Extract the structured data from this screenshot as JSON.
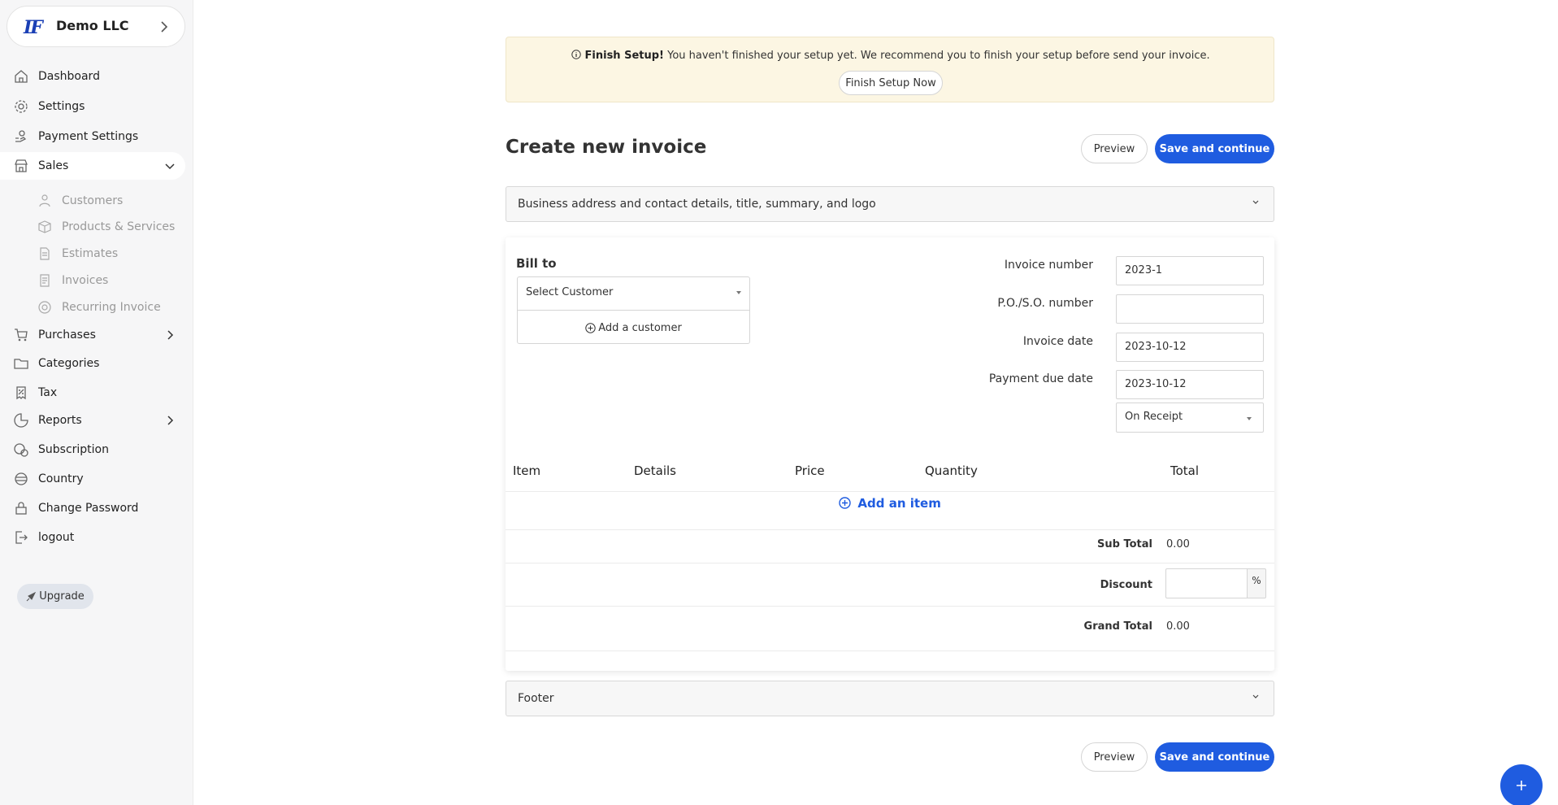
{
  "org": {
    "logo": "IF",
    "name": "Demo LLC"
  },
  "sidebar": {
    "items": [
      {
        "label": "Dashboard",
        "icon": "house-icon"
      },
      {
        "label": "Settings",
        "icon": "gear-icon"
      },
      {
        "label": "Payment Settings",
        "icon": "hand-coin-icon"
      },
      {
        "label": "Sales",
        "icon": "shop-icon",
        "expanded": true
      },
      {
        "label": "Purchases",
        "icon": "cart-icon"
      },
      {
        "label": "Categories",
        "icon": "folder-icon"
      },
      {
        "label": "Tax",
        "icon": "tax-icon"
      },
      {
        "label": "Reports",
        "icon": "chart-icon"
      },
      {
        "label": "Subscription",
        "icon": "subscription-icon"
      },
      {
        "label": "Country",
        "icon": "globe-icon"
      },
      {
        "label": "Change Password",
        "icon": "lock-icon"
      },
      {
        "label": "logout",
        "icon": "logout-icon"
      }
    ],
    "sales_sub": [
      {
        "label": "Customers",
        "icon": "customers-icon"
      },
      {
        "label": "Products & Services",
        "icon": "box-icon"
      },
      {
        "label": "Estimates",
        "icon": "document-icon"
      },
      {
        "label": "Invoices",
        "icon": "invoice-icon"
      },
      {
        "label": "Recurring Invoice",
        "icon": "recurring-icon"
      }
    ],
    "upgrade_label": "Upgrade"
  },
  "banner": {
    "title": "Finish Setup!",
    "message": "You haven't finished your setup yet. We recommend you to finish your setup before send your invoice.",
    "button": "Finish Setup Now"
  },
  "page": {
    "title": "Create new invoice",
    "preview_label": "Preview",
    "save_label": "Save and continue"
  },
  "business_section": {
    "label": "Business address and contact details, title, summary, and logo"
  },
  "bill_to": {
    "label": "Bill to",
    "select_placeholder": "Select Customer",
    "add_customer": "Add a customer"
  },
  "fields": {
    "invoice_number": {
      "label": "Invoice number",
      "value": "2023-1"
    },
    "po_number": {
      "label": "P.O./S.O. number",
      "value": ""
    },
    "invoice_date": {
      "label": "Invoice date",
      "value": "2023-10-12"
    },
    "due_date": {
      "label": "Payment due date",
      "value": "2023-10-12"
    },
    "terms": {
      "value": "On Receipt"
    }
  },
  "table": {
    "headers": [
      "Item",
      "Details",
      "Price",
      "Quantity",
      "Total"
    ],
    "add_item": "Add an item"
  },
  "summary": {
    "subtotal_label": "Sub Total",
    "subtotal": "0.00",
    "discount_label": "Discount",
    "discount_unit": "%",
    "grand_total_label": "Grand Total",
    "grand_total": "0.00"
  },
  "footer_section": {
    "label": "Footer"
  },
  "colors": {
    "primary": "#1f5ce0",
    "banner_bg": "#fcf6e3",
    "sidebar_bg": "#f6f6f7"
  }
}
